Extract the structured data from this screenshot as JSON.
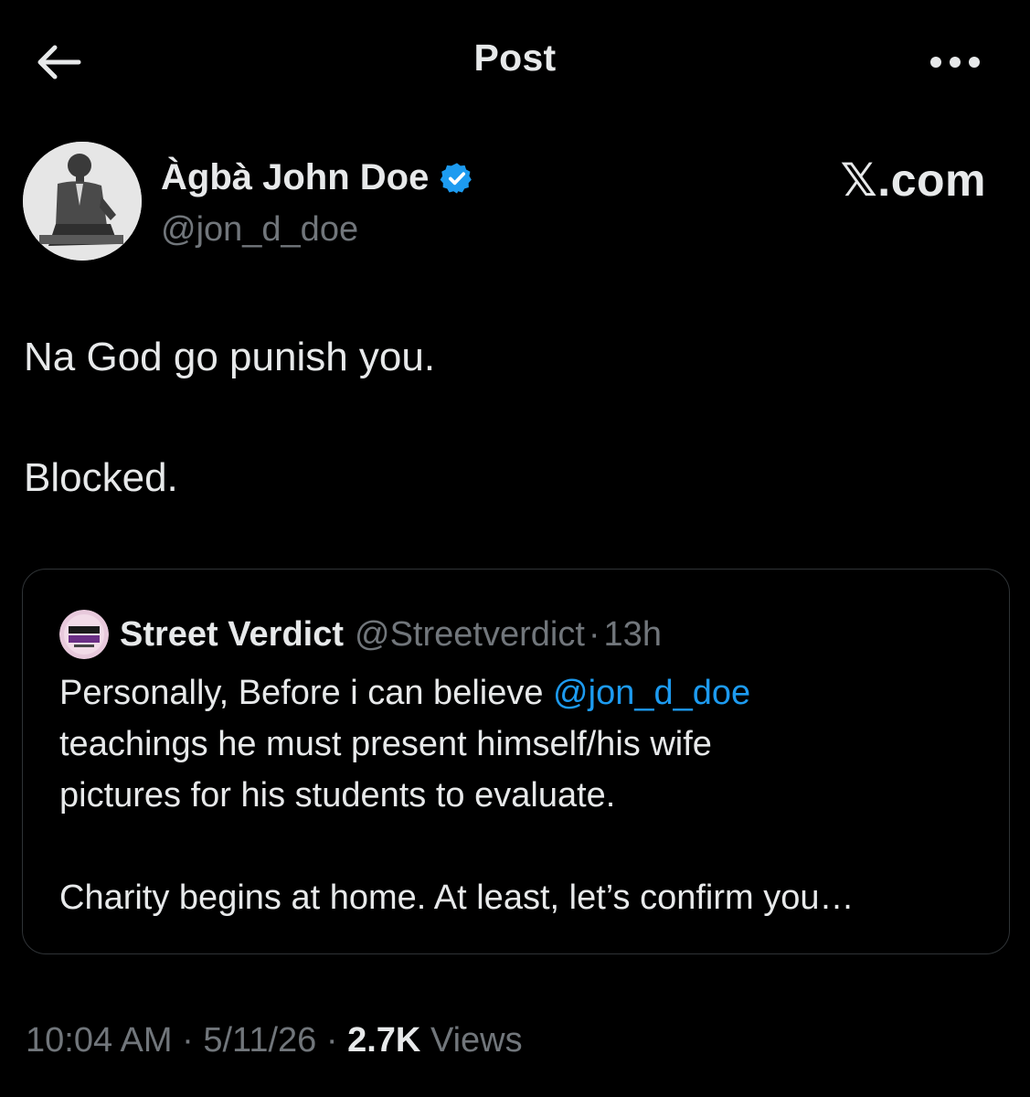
{
  "header": {
    "title": "Post",
    "back_icon": "arrow-left-icon",
    "more_icon": "more-horizontal-icon"
  },
  "post": {
    "author_name": "Àgbà John Doe",
    "author_handle": "@jon_d_doe",
    "verified_color": "#1d9bf0",
    "source_label": "𝕏.com",
    "lines": [
      "Na God go punish you.",
      "Blocked."
    ]
  },
  "quote": {
    "name": "Street Verdict",
    "handle": "@Streetverdict",
    "separator": "·",
    "time": "13h",
    "text_prefix": "Personally, Before i can believe ",
    "mention": "@jon_d_doe",
    "line2": "teachings he must present himself/his wife",
    "line3": "pictures for his students to evaluate.",
    "line4": "Charity begins at home. At least, let’s confirm you…"
  },
  "meta": {
    "time": "10:04 AM",
    "separator": "·",
    "date": "5/11/26",
    "views_count": "2.7K",
    "views_label": "Views"
  },
  "colors": {
    "background": "#000000",
    "text": "#e7e9ea",
    "muted": "#71767b",
    "accent": "#1d9bf0",
    "border": "#2f3336"
  }
}
